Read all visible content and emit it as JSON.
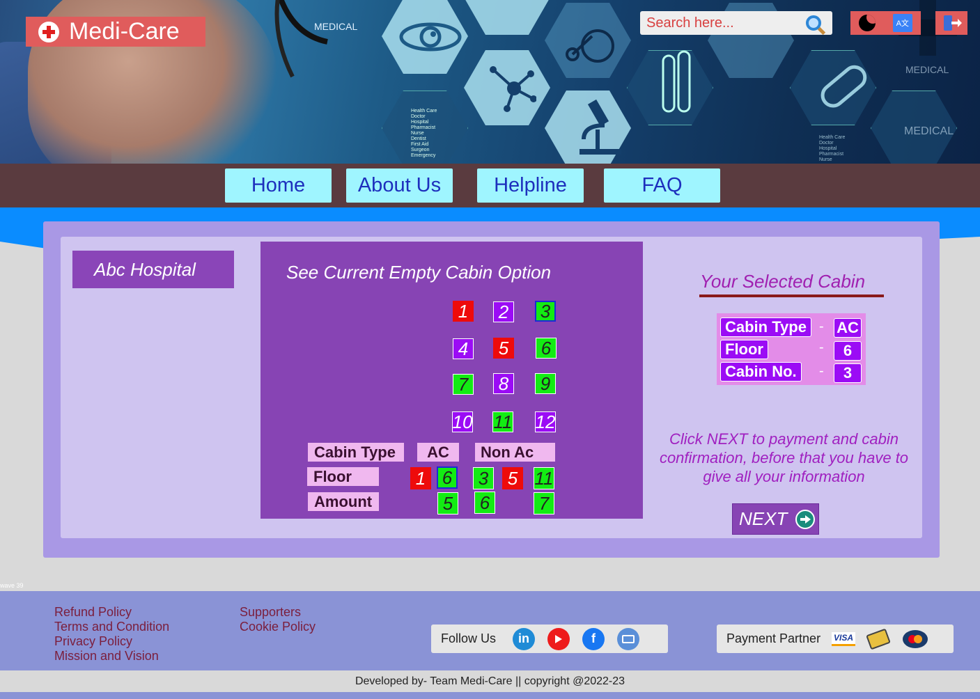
{
  "brand": {
    "name": "Medi-Care"
  },
  "banner": {
    "labels": [
      "MEDICAL",
      "MEDICAL",
      "MEDICAL"
    ],
    "tiny_list": [
      "Health Care",
      "Doctor",
      "Hospital",
      "Pharmacist",
      "Nurse",
      "Dentist",
      "First Aid",
      "Surgeon",
      "Emergency"
    ],
    "tiny_list2": [
      "Health Care",
      "Doctor",
      "Hospital",
      "Pharmacist",
      "Nurse"
    ]
  },
  "search": {
    "placeholder": "Search here..."
  },
  "tools": {
    "translate_label": "A文"
  },
  "nav": {
    "items": [
      "Home",
      "About Us",
      "Helpline",
      "FAQ"
    ]
  },
  "hospital": {
    "name": "Abc Hospital"
  },
  "cabins": {
    "title": "See Current Empty Cabin Option",
    "grid": [
      {
        "num": "1",
        "status": "red"
      },
      {
        "num": "2",
        "status": "violet"
      },
      {
        "num": "3",
        "status": "green",
        "selected": true
      },
      {
        "num": "4",
        "status": "violet"
      },
      {
        "num": "5",
        "status": "red"
      },
      {
        "num": "6",
        "status": "green"
      },
      {
        "num": "7",
        "status": "green"
      },
      {
        "num": "8",
        "status": "violet"
      },
      {
        "num": "9",
        "status": "green"
      },
      {
        "num": "10",
        "status": "violet"
      },
      {
        "num": "11",
        "status": "green"
      },
      {
        "num": "12",
        "status": "violet"
      }
    ],
    "legend": {
      "cabin_type_label": "Cabin Type",
      "ac_label": "AC",
      "nonac_label": "Non Ac",
      "floor_label": "Floor",
      "amount_label": "Amount",
      "floors": [
        "1",
        "6",
        "3",
        "5",
        "11"
      ],
      "amounts": [
        "5",
        "6",
        "7"
      ]
    }
  },
  "selected": {
    "title": "Your Selected Cabin",
    "rows": [
      {
        "label": "Cabin Type",
        "value": "AC"
      },
      {
        "label": "Floor",
        "value": "6"
      },
      {
        "label": "Cabin No.",
        "value": "3"
      }
    ],
    "dash": "-"
  },
  "info_text": "Click NEXT to payment and cabin confirmation, before that you have to give all your information",
  "next_label": "NEXT",
  "wave_tag": "wave 39",
  "footer": {
    "col1": [
      "Refund Policy",
      "Terms and Condition",
      "Privacy Policy",
      "Mission and Vision"
    ],
    "col2": [
      "Supporters",
      "Cookie Policy"
    ],
    "follow_label": "Follow Us",
    "payment_label": "Payment Partner",
    "visa_label": "VISA",
    "copyright": "Developed by- Team Medi-Care || copyright @2022-23"
  }
}
